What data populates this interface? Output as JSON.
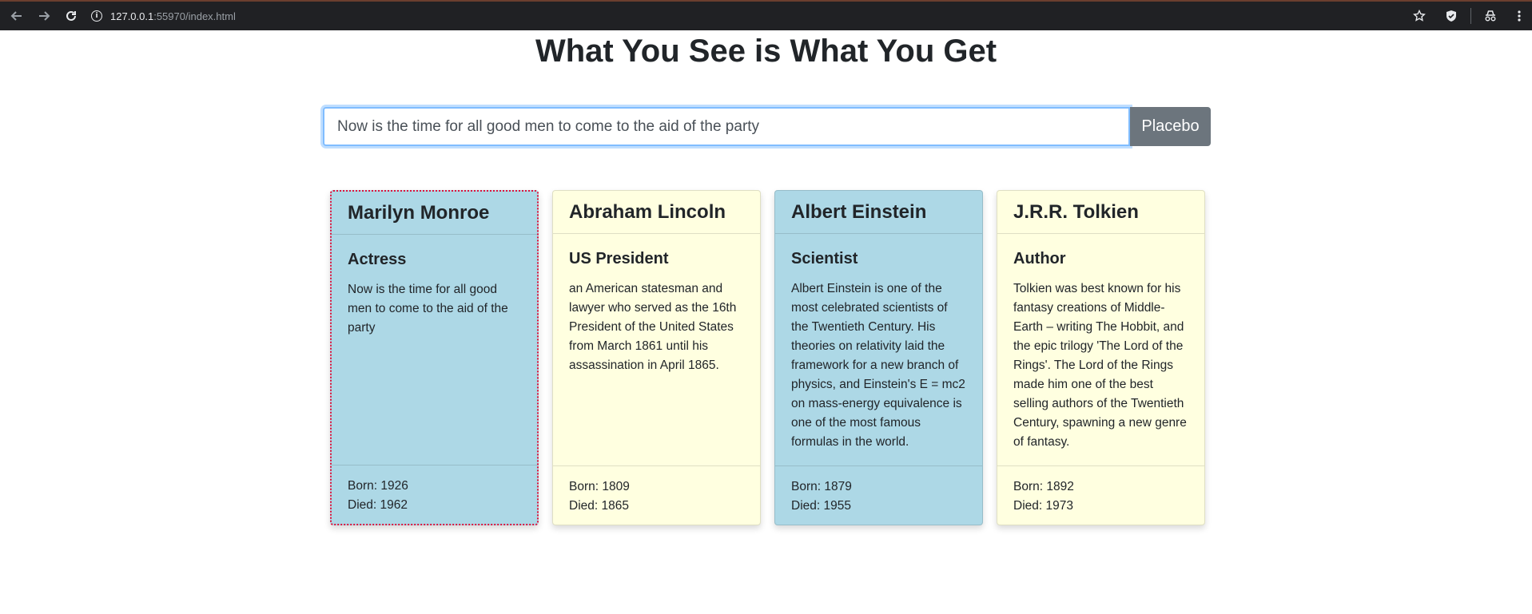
{
  "browser": {
    "url_host": "127.0.0.1",
    "url_rest": ":55970/index.html"
  },
  "page": {
    "title": "What You See is What You Get"
  },
  "search": {
    "value": "Now is the time for all good men to come to the aid of the party",
    "button_label": "Placebo"
  },
  "cards": [
    {
      "name": "Marilyn Monroe",
      "role": "Actress",
      "text": "Now is the time for all good men to come to the aid of the party",
      "born": "Born: 1926",
      "died": "Died: 1962"
    },
    {
      "name": "Abraham Lincoln",
      "role": "US President",
      "text": "an American statesman and lawyer who served as the 16th President of the United States from March 1861 until his assassination in April 1865.",
      "born": "Born: 1809",
      "died": "Died: 1865"
    },
    {
      "name": "Albert Einstein",
      "role": "Scientist",
      "text": "Albert Einstein is one of the most celebrated scientists of the Twentieth Century. His theories on relativity laid the framework for a new branch of physics, and Einstein's E = mc2 on mass-energy equivalence is one of the most famous formulas in the world.",
      "born": "Born: 1879",
      "died": "Died: 1955"
    },
    {
      "name": "J.R.R. Tolkien",
      "role": "Author",
      "text": "Tolkien was best known for his fantasy creations of Middle-Earth – writing The Hobbit, and the epic trilogy 'The Lord of the Rings'. The Lord of the Rings made him one of the best selling authors of the Twentieth Century, spawning a new genre of fantasy.",
      "born": "Born: 1892",
      "died": "Died: 1973"
    }
  ],
  "colors": {
    "card_blue": "#add8e6",
    "card_yellow": "#ffffe0",
    "selected_border": "#dc143c",
    "button_gray": "#6c757d"
  }
}
